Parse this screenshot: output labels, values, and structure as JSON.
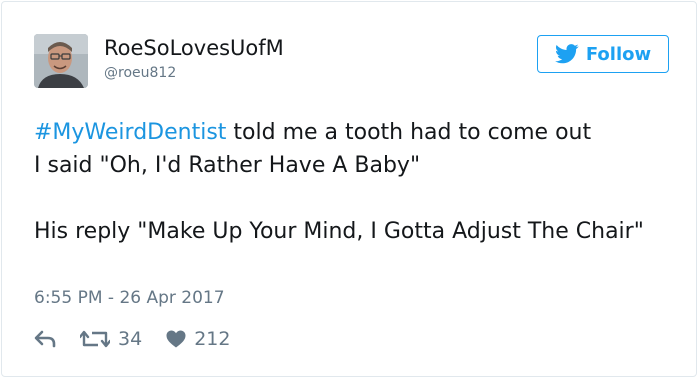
{
  "tweet": {
    "display_name": "RoeSoLovesUofM",
    "handle": "@roeu812",
    "follow_label": "Follow",
    "hashtag": "#MyWeirdDentist",
    "line1_rest": " told me a tooth had to come out",
    "line2": "I said \"Oh, I'd Rather Have A Baby\"",
    "reply_line": "His reply \"Make Up Your Mind, I Gotta Adjust The Chair\"",
    "timestamp": "6:55 PM - 26 Apr 2017",
    "retweet_count": "34",
    "like_count": "212"
  },
  "icons": {
    "follow": "twitter-bird-icon",
    "reply": "reply-arrow-icon",
    "retweet": "retweet-icon",
    "like": "heart-icon"
  },
  "colors": {
    "accent": "#1da1f2",
    "hashtag": "#1b95e0",
    "muted": "#657786",
    "text": "#14171a"
  }
}
